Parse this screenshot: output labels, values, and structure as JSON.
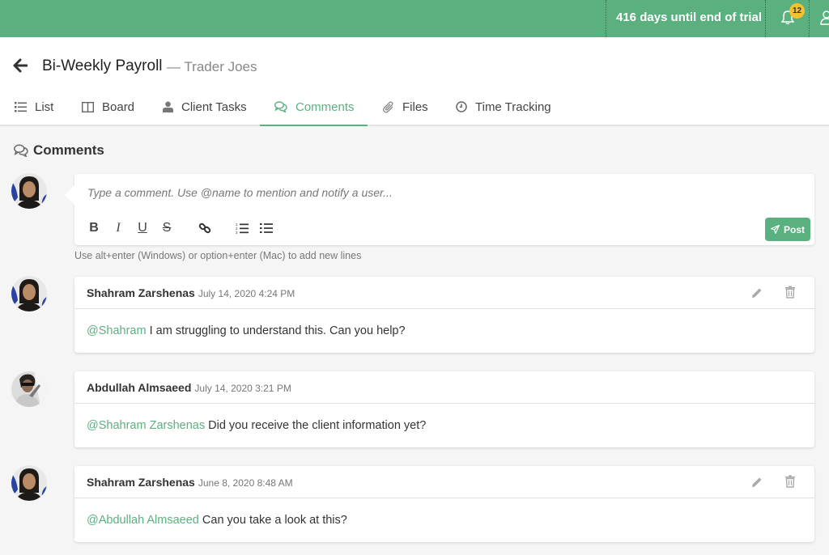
{
  "topbar": {
    "trial_text": "416 days until end of trial",
    "notification_count": "12",
    "brand_color": "#5bb07f"
  },
  "header": {
    "title": "Bi-Weekly Payroll",
    "subtitle": "— Trader Joes",
    "tabs": [
      {
        "label": "List",
        "icon": "list-icon",
        "active": false
      },
      {
        "label": "Board",
        "icon": "board-icon",
        "active": false
      },
      {
        "label": "Client Tasks",
        "icon": "user-icon",
        "active": false
      },
      {
        "label": "Comments",
        "icon": "comments-icon",
        "active": true
      },
      {
        "label": "Files",
        "icon": "paperclip-icon",
        "active": false
      },
      {
        "label": "Time Tracking",
        "icon": "clock-icon",
        "active": false
      }
    ]
  },
  "section": {
    "title": "Comments"
  },
  "composer": {
    "placeholder": "Type a comment. Use @name to mention and notify a user...",
    "value": "",
    "toolbar": [
      "bold",
      "italic",
      "underline",
      "strikethrough",
      "link",
      "ordered-list",
      "bullet-list"
    ],
    "post_label": "Post",
    "hint": "Use alt+enter (Windows) or option+enter (Mac) to add new lines"
  },
  "comments": [
    {
      "author": "Shahram Zarshenas",
      "timestamp": "July 14, 2020 4:24 PM",
      "mention": "@Shahram",
      "text": " I am struggling to understand this. Can you help?",
      "editable": true
    },
    {
      "author": "Abdullah Almsaeed",
      "timestamp": "July 14, 2020 3:21 PM",
      "mention": "@Shahram Zarshenas",
      "text": " Did you receive the client information yet?",
      "editable": false
    },
    {
      "author": "Shahram Zarshenas",
      "timestamp": "June 8, 2020 8:48 AM",
      "mention": "@Abdullah Almsaeed",
      "text": " Can you take a look at this?",
      "editable": true
    }
  ]
}
